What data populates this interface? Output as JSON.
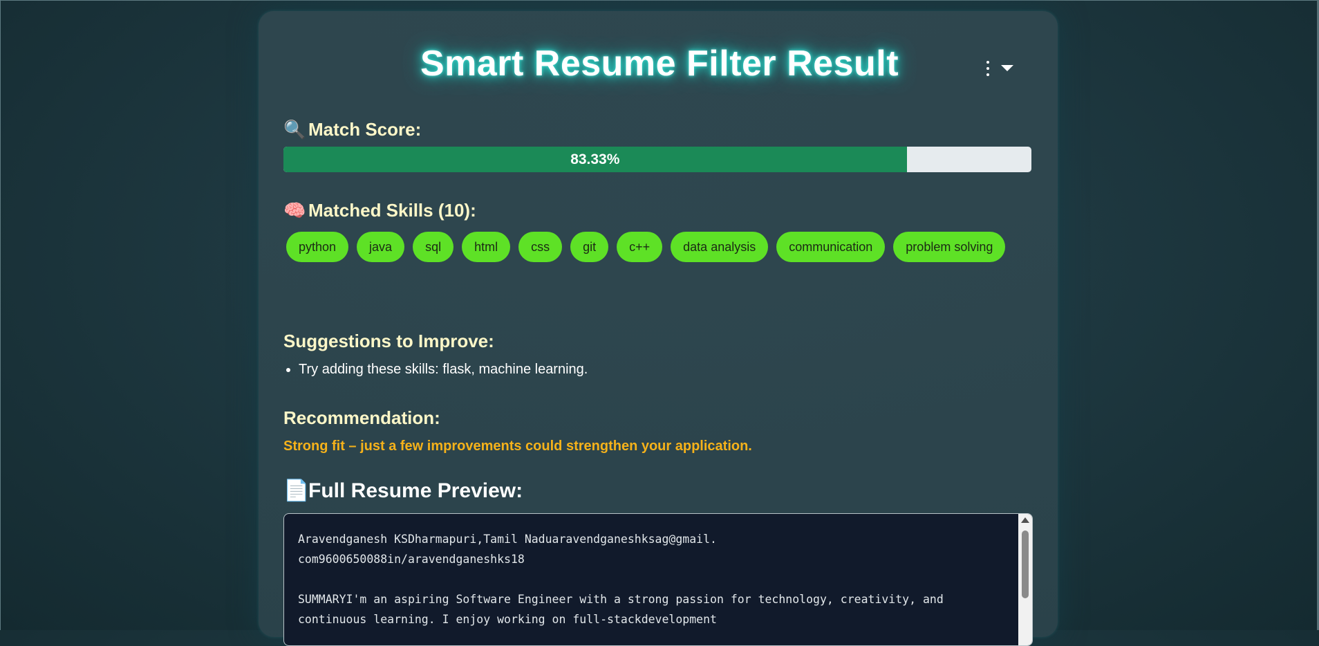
{
  "header": {
    "title": "Smart Resume Filter Result"
  },
  "menu": {
    "kebab_icon": "more-vert-icon",
    "caret_icon": "caret-down-icon"
  },
  "match": {
    "emoji": "🔍",
    "heading": "Match Score:",
    "score_label": "83.33%",
    "score_percent": 83.33
  },
  "skills": {
    "emoji": "🧠",
    "heading": "Matched Skills (10):",
    "items": [
      "python",
      "java",
      "sql",
      "html",
      "css",
      "git",
      "c++",
      "data analysis",
      "communication",
      "problem solving"
    ]
  },
  "suggestions": {
    "heading": "Suggestions to Improve:",
    "items": [
      "Try adding these skills: flask, machine learning."
    ]
  },
  "recommendation": {
    "heading": "Recommendation:",
    "text": "Strong fit – just a few improvements could strengthen your application."
  },
  "preview": {
    "emoji": "📄",
    "heading": "Full Resume Preview:",
    "text": "Aravendganesh KSDharmapuri,Tamil Naduaravendganeshksag@gmail.\ncom9600650088in/aravendganeshks18\n\nSUMMARYI'm an aspiring Software Engineer with a strong passion for technology, creativity, and\ncontinuous learning. I enjoy working on full-stackdevelopment"
  },
  "colors": {
    "accent_glow": "#27e0d0",
    "progress_fill": "#1b8a57",
    "chip_bg": "#5ee126",
    "heading": "#fdf7c8",
    "recommendation": "#f6b21a"
  }
}
